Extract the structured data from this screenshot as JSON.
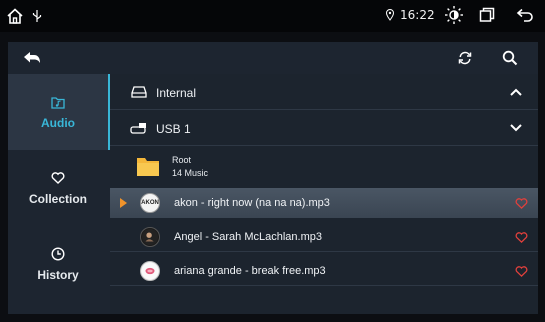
{
  "status_bar": {
    "time": "16:22",
    "icons": [
      "home-icon",
      "usb-icon",
      "location-icon",
      "brightness-icon",
      "window-icon",
      "back-icon"
    ]
  },
  "toolbar": {
    "icons": [
      "back-arrow-icon",
      "refresh-icon",
      "search-icon"
    ]
  },
  "sidebar": {
    "items": [
      {
        "label": "Audio",
        "icon": "music-folder-icon",
        "active": true
      },
      {
        "label": "Collection",
        "icon": "heart-icon",
        "active": false
      },
      {
        "label": "History",
        "icon": "clock-icon",
        "active": false
      }
    ]
  },
  "devices": [
    {
      "label": "Internal",
      "icon": "drive-icon",
      "expanded": true
    },
    {
      "label": "USB 1",
      "icon": "usb-drive-icon",
      "expanded": false
    }
  ],
  "folder": {
    "name": "Root",
    "count": "14 Music"
  },
  "songs": [
    {
      "title": "akon - right now (na na na).mp3",
      "art": "AKON",
      "playing": true
    },
    {
      "title": "Angel - Sarah McLachlan.mp3",
      "art": "",
      "playing": false
    },
    {
      "title": "ariana grande - break free.mp3",
      "art": "",
      "playing": false
    }
  ],
  "colors": {
    "accent": "#39b7d8",
    "heart": "#e0403c",
    "play_marker": "#f0932b",
    "folder": "#f4b73a"
  }
}
